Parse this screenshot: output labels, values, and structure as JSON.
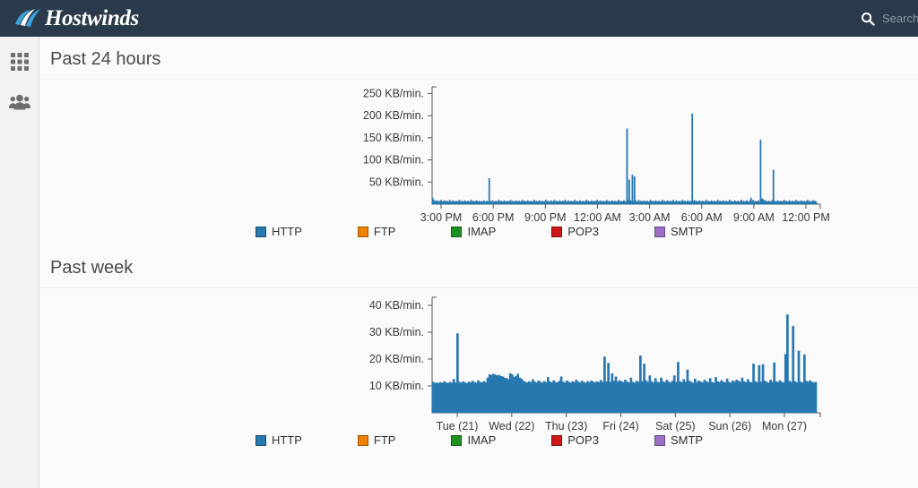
{
  "header": {
    "brand": "Hostwinds",
    "logo_icon": "hostwinds-wave-logo",
    "search_icon": "search-icon",
    "search_placeholder": "Search",
    "search_value": "",
    "background_color": "#2b3a4a",
    "brand_color": "#ffffff",
    "accent_color": "#3aa3dc"
  },
  "sidebar": {
    "items": [
      {
        "name": "apps-grid-icon",
        "label": ""
      },
      {
        "name": "users-group-icon",
        "label": ""
      }
    ],
    "background_color": "#f2f2f2",
    "icon_color": "#6e6e6e"
  },
  "sections": [
    {
      "id": "past-24-hours",
      "title": "Past 24 hours"
    },
    {
      "id": "past-week",
      "title": "Past week"
    }
  ],
  "legend_entries": [
    {
      "label": "HTTP",
      "color": "#2878b0"
    },
    {
      "label": "FTP",
      "color": "#f08000"
    },
    {
      "label": "IMAP",
      "color": "#1f9120"
    },
    {
      "label": "POP3",
      "color": "#cc1818"
    },
    {
      "label": "SMTP",
      "color": "#9a6fc4"
    }
  ],
  "chart_data": [
    {
      "id": "past-24-hours-chart",
      "type": "area",
      "title": "Past 24 hours",
      "xlabel": "",
      "ylabel": "KB/min.",
      "unit": "KB/min.",
      "ylim": [
        0,
        265
      ],
      "yticks": [
        50,
        100,
        150,
        200,
        250
      ],
      "ytick_labels": [
        "50 KB/min.",
        "100 KB/min.",
        "150 KB/min.",
        "200 KB/min.",
        "250 KB/min."
      ],
      "grid": false,
      "legend_position": "bottom",
      "xticks": [
        0,
        3,
        6,
        9,
        12,
        15,
        18,
        21
      ],
      "xtick_labels": [
        "3:00 PM",
        "6:00 PM",
        "9:00 PM",
        "12:00 AM",
        "3:00 AM",
        "6:00 AM",
        "9:00 AM",
        "12:00 PM"
      ],
      "series": [
        {
          "name": "HTTP",
          "color": "#2878b0",
          "values": [
            14,
            9,
            7,
            6,
            8,
            5,
            7,
            6,
            9,
            5,
            6,
            8,
            5,
            7,
            6,
            5,
            9,
            6,
            5,
            8,
            6,
            5,
            7,
            5,
            6,
            9,
            5,
            7,
            6,
            5,
            8,
            6,
            5,
            7,
            5,
            6,
            9,
            5,
            7,
            5,
            6,
            8,
            5,
            6,
            7,
            5,
            6,
            5,
            8,
            5,
            6,
            7,
            5,
            58,
            6,
            5,
            8,
            6,
            5,
            7,
            5,
            6,
            9,
            5,
            7,
            6,
            5,
            8,
            5,
            6,
            7,
            5,
            6,
            9,
            5,
            7,
            5,
            6,
            8,
            5,
            6,
            7,
            5,
            6,
            9,
            5,
            7,
            6,
            5,
            8,
            5,
            6,
            7,
            5,
            6,
            9,
            5,
            7,
            5,
            6,
            8,
            5,
            6,
            7,
            5,
            6,
            9,
            5,
            7,
            6,
            5,
            8,
            5,
            6,
            9,
            5,
            7,
            5,
            6,
            8,
            5,
            6,
            7,
            5,
            9,
            6,
            5,
            8,
            5,
            6,
            7,
            5,
            6,
            9,
            5,
            7,
            5,
            6,
            8,
            5,
            6,
            7,
            5,
            6,
            9,
            5,
            7,
            5,
            6,
            8,
            5,
            6,
            7,
            5,
            9,
            6,
            5,
            8,
            5,
            6,
            7,
            5,
            6,
            9,
            5,
            7,
            5,
            6,
            8,
            5,
            6,
            7,
            5,
            6,
            9,
            5,
            7,
            5,
            6,
            8,
            5,
            6,
            170,
            9,
            55,
            8,
            7,
            66,
            6,
            62,
            8,
            6,
            5,
            9,
            5,
            7,
            6,
            5,
            8,
            5,
            6,
            7,
            5,
            6,
            9,
            5,
            7,
            5,
            6,
            8,
            5,
            6,
            7,
            5,
            6,
            9,
            5,
            7,
            5,
            6,
            8,
            5,
            6,
            7,
            5,
            9,
            6,
            5,
            8,
            5,
            6,
            7,
            5,
            6,
            9,
            5,
            7,
            5,
            6,
            8,
            5,
            6,
            7,
            204,
            6,
            9,
            5,
            7,
            5,
            6,
            8,
            5,
            6,
            7,
            5,
            6,
            9,
            5,
            7,
            5,
            6,
            8,
            5,
            6,
            7,
            5,
            6,
            9,
            5,
            7,
            5,
            6,
            8,
            5,
            6,
            7,
            5,
            6,
            9,
            5,
            7,
            5,
            6,
            8,
            5,
            6,
            7,
            5,
            6,
            9,
            5,
            7,
            5,
            6,
            8,
            5,
            6,
            7,
            14,
            6,
            9,
            5,
            7,
            5,
            6,
            8,
            5,
            145,
            13,
            11,
            9,
            6,
            8,
            5,
            6,
            7,
            5,
            6,
            9,
            77,
            7,
            5,
            6,
            8,
            5,
            6,
            7,
            5,
            6,
            9,
            5,
            7,
            5,
            6,
            8,
            5,
            6,
            7,
            5,
            6,
            9,
            5,
            7,
            5,
            6,
            8,
            5,
            6,
            7,
            5,
            6,
            9,
            5,
            7,
            5,
            6,
            8,
            6,
            7,
            5
          ]
        },
        {
          "name": "FTP",
          "color": "#f08000",
          "values": []
        },
        {
          "name": "IMAP",
          "color": "#1f9120",
          "values": []
        },
        {
          "name": "POP3",
          "color": "#cc1818",
          "values": []
        },
        {
          "name": "SMTP",
          "color": "#9a6fc4",
          "values": []
        }
      ],
      "notable_peaks": [
        {
          "x_label": "~3:40 PM",
          "value": 58
        },
        {
          "x_label": "~2:10 AM",
          "value": 170
        },
        {
          "x_label": "~2:30 AM",
          "value": 66
        },
        {
          "x_label": "~2:45 AM",
          "value": 62
        },
        {
          "x_label": "~6:00 AM",
          "value": 204
        },
        {
          "x_label": "~9:50 AM",
          "value": 145
        },
        {
          "x_label": "~10:40 AM",
          "value": 77
        }
      ]
    },
    {
      "id": "past-week-chart",
      "type": "area",
      "title": "Past week",
      "xlabel": "",
      "ylabel": "KB/min.",
      "unit": "KB/min.",
      "ylim": [
        0,
        43
      ],
      "yticks": [
        10,
        20,
        30,
        40
      ],
      "ytick_labels": [
        "10 KB/min.",
        "20 KB/min.",
        "30 KB/min.",
        "40 KB/min."
      ],
      "grid": false,
      "legend_position": "bottom",
      "xticks": [
        0,
        1,
        2,
        3,
        4,
        5,
        6
      ],
      "xtick_labels": [
        "Tue (21)",
        "Wed (22)",
        "Thu (23)",
        "Fri (24)",
        "Sat (25)",
        "Sun (26)",
        "Mon (27)"
      ],
      "series": [
        {
          "name": "HTTP",
          "color": "#2878b0",
          "values": [
            11.5,
            11.0,
            11.2,
            11.0,
            11.3,
            11.1,
            11.6,
            11.2,
            11.0,
            11.4,
            11.1,
            12.5,
            11.2,
            29.5,
            11.4,
            11.1,
            11.6,
            11.2,
            11.0,
            11.5,
            11.2,
            11.8,
            11.3,
            11.1,
            12.0,
            11.4,
            11.2,
            11.7,
            11.3,
            13.0,
            14.2,
            14.0,
            14.4,
            14.1,
            13.8,
            14.0,
            13.6,
            13.4,
            13.0,
            12.8,
            12.4,
            14.6,
            14.2,
            13.2,
            13.6,
            14.4,
            13.0,
            12.6,
            11.8,
            11.4,
            11.2,
            11.6,
            11.3,
            12.4,
            11.5,
            11.2,
            11.9,
            11.4,
            11.1,
            11.7,
            11.3,
            13.2,
            11.6,
            11.2,
            12.0,
            11.4,
            11.2,
            11.8,
            13.4,
            11.5,
            11.2,
            11.9,
            11.4,
            11.1,
            11.6,
            11.3,
            12.2,
            11.5,
            11.2,
            11.8,
            11.4,
            11.1,
            11.7,
            11.3,
            11.9,
            11.5,
            11.2,
            11.6,
            11.3,
            12.1,
            11.4,
            20.8,
            11.6,
            18.5,
            11.4,
            14.6,
            11.8,
            13.4,
            11.5,
            12.0,
            11.6,
            11.3,
            12.2,
            11.5,
            11.2,
            13.0,
            11.4,
            11.1,
            11.8,
            11.4,
            21.2,
            11.6,
            18.2,
            12.0,
            11.4,
            13.8,
            11.6,
            11.2,
            12.8,
            11.5,
            11.2,
            13.0,
            11.6,
            11.3,
            12.2,
            11.5,
            11.2,
            11.8,
            13.8,
            11.4,
            18.8,
            11.6,
            11.3,
            12.4,
            11.5,
            16.0,
            11.8,
            11.4,
            11.1,
            12.6,
            11.3,
            11.9,
            11.5,
            11.2,
            12.2,
            11.6,
            11.3,
            12.8,
            11.4,
            11.1,
            13.2,
            11.6,
            11.3,
            12.0,
            11.5,
            11.2,
            12.6,
            11.4,
            11.1,
            11.9,
            11.5,
            12.2,
            11.8,
            11.4,
            13.0,
            11.6,
            11.3,
            12.4,
            11.5,
            11.2,
            18.2,
            11.6,
            11.3,
            17.6,
            11.5,
            18.0,
            11.8,
            11.4,
            11.1,
            12.2,
            11.5,
            18.6,
            11.6,
            11.3,
            12.0,
            11.4,
            11.2,
            21.8,
            36.5,
            11.8,
            11.4,
            32.2,
            11.6,
            11.3,
            23.0,
            11.5,
            11.2,
            21.6,
            11.8,
            11.4,
            12.0,
            11.5,
            11.2,
            11.4
          ]
        },
        {
          "name": "FTP",
          "color": "#f08000",
          "values": []
        },
        {
          "name": "IMAP",
          "color": "#1f9120",
          "values": []
        },
        {
          "name": "POP3",
          "color": "#cc1818",
          "values": []
        },
        {
          "name": "SMTP",
          "color": "#9a6fc4",
          "values": []
        }
      ],
      "notable_peaks": [
        {
          "x_label": "Tue (21)",
          "value": 29.5
        },
        {
          "x_label": "Fri (24)",
          "value": 21.2
        },
        {
          "x_label": "Mon (27)",
          "value": 36.5
        },
        {
          "x_label": "Mon (27)",
          "value": 32.2
        },
        {
          "x_label": "Mon (27)",
          "value": 23.0
        },
        {
          "x_label": "Mon (27)",
          "value": 21.6
        }
      ]
    }
  ]
}
